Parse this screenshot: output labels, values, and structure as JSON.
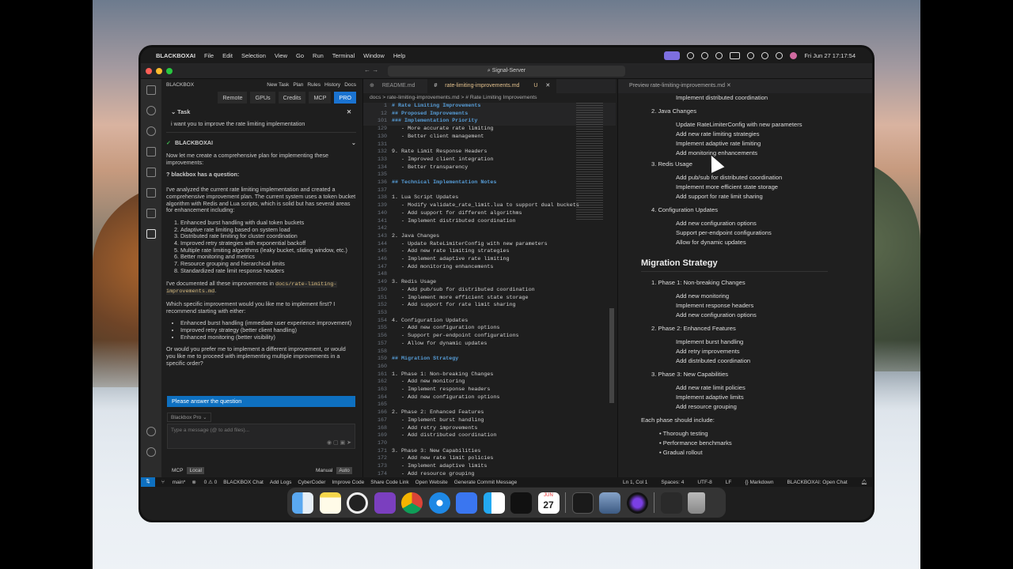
{
  "menubar": {
    "app": "BLACKBOXAI",
    "items": [
      "File",
      "Edit",
      "Selection",
      "View",
      "Go",
      "Run",
      "Terminal",
      "Window",
      "Help"
    ],
    "clock": "Fri Jun 27  17:17:54"
  },
  "titlebar": {
    "search": "Signal-Server"
  },
  "sidebar": {
    "title": "BLACKBOX",
    "links": [
      "New Task",
      "Plan",
      "Rules",
      "History",
      "Docs"
    ],
    "tabs": [
      "Remote",
      "GPUs",
      "Credits",
      "MCP",
      "PRO"
    ],
    "task_label": "Task",
    "task_text": "i want you to improve the rate limiting implementation",
    "agent_name": "BLACKBOXAI",
    "intro": "Now let me create a comprehensive plan for implementing these improvements:",
    "question_title": "blackbox has a question:",
    "analysis": "I've analyzed the current rate limiting implementation and created a comprehensive improvement plan. The current system uses a token bucket algorithm with Redis and Lua scripts, which is solid but has several areas for enhancement including:",
    "list": [
      "Enhanced burst handling with dual token buckets",
      "Adaptive rate limiting based on system load",
      "Distributed rate limiting for cluster coordination",
      "Improved retry strategies with exponential backoff",
      "Multiple rate limiting algorithms (leaky bucket, sliding window, etc.)",
      "Better monitoring and metrics",
      "Resource grouping and hierarchical limits",
      "Standardized rate limit response headers"
    ],
    "doc_prefix": "I've documented all these improvements in",
    "doc_path": "docs/rate-limiting-improvements.md",
    "which": "Which specific improvement would you like me to implement first? I recommend starting with either:",
    "recommend": [
      "Enhanced burst handling (immediate user experience improvement)",
      "Improved retry strategy (better client handling)",
      "Enhanced monitoring (better visibility)"
    ],
    "or_text": "Or would you prefer me to implement a different improvement, or would you like me to proceed with implementing multiple improvements in a specific order?",
    "answer_button": "Please answer the question",
    "model": "Blackbox Pro",
    "input_placeholder": "Type a message (@ to add files)...",
    "mcp": "MCP",
    "local": "Local",
    "manual": "Manual",
    "auto": "Auto"
  },
  "editor": {
    "tabs": [
      "README.md",
      "rate-limiting-improvements.md"
    ],
    "tab_badge": "U",
    "breadcrumb": "docs  >  rate-limiting-improvements.md  >  # Rate Limiting Improvements",
    "lines": [
      {
        "n": "1",
        "t": "# Rate Limiting Improvements",
        "h": true
      },
      {
        "n": "12",
        "t": "## Proposed Improvements",
        "h": true
      },
      {
        "n": "101",
        "t": "### Implementation Priority",
        "h": true
      },
      {
        "n": "129",
        "t": "   - More accurate rate limiting"
      },
      {
        "n": "130",
        "t": "   - Better client management"
      },
      {
        "n": "131",
        "t": ""
      },
      {
        "n": "132",
        "t": "9. Rate Limit Response Headers"
      },
      {
        "n": "133",
        "t": "   - Improved client integration"
      },
      {
        "n": "134",
        "t": "   - Better transparency"
      },
      {
        "n": "135",
        "t": ""
      },
      {
        "n": "136",
        "t": "## Technical Implementation Notes",
        "h": true
      },
      {
        "n": "137",
        "t": ""
      },
      {
        "n": "138",
        "t": "1. Lua Script Updates"
      },
      {
        "n": "139",
        "t": "   - Modify validate_rate_limit.lua to support dual buckets"
      },
      {
        "n": "140",
        "t": "   - Add support for different algorithms"
      },
      {
        "n": "141",
        "t": "   - Implement distributed coordination"
      },
      {
        "n": "142",
        "t": ""
      },
      {
        "n": "143",
        "t": "2. Java Changes"
      },
      {
        "n": "144",
        "t": "   - Update RateLimiterConfig with new parameters"
      },
      {
        "n": "145",
        "t": "   - Add new rate limiting strategies"
      },
      {
        "n": "146",
        "t": "   - Implement adaptive rate limiting"
      },
      {
        "n": "147",
        "t": "   - Add monitoring enhancements"
      },
      {
        "n": "148",
        "t": ""
      },
      {
        "n": "149",
        "t": "3. Redis Usage"
      },
      {
        "n": "150",
        "t": "   - Add pub/sub for distributed coordination"
      },
      {
        "n": "151",
        "t": "   - Implement more efficient state storage"
      },
      {
        "n": "152",
        "t": "   - Add support for rate limit sharing"
      },
      {
        "n": "153",
        "t": ""
      },
      {
        "n": "154",
        "t": "4. Configuration Updates"
      },
      {
        "n": "155",
        "t": "   - Add new configuration options"
      },
      {
        "n": "156",
        "t": "   - Support per-endpoint configurations"
      },
      {
        "n": "157",
        "t": "   - Allow for dynamic updates"
      },
      {
        "n": "158",
        "t": ""
      },
      {
        "n": "159",
        "t": "## Migration Strategy",
        "h": true
      },
      {
        "n": "160",
        "t": ""
      },
      {
        "n": "161",
        "t": "1. Phase 1: Non-breaking Changes"
      },
      {
        "n": "162",
        "t": "   - Add new monitoring"
      },
      {
        "n": "163",
        "t": "   - Implement response headers"
      },
      {
        "n": "164",
        "t": "   - Add new configuration options"
      },
      {
        "n": "165",
        "t": ""
      },
      {
        "n": "166",
        "t": "2. Phase 2: Enhanced Features"
      },
      {
        "n": "167",
        "t": "   - Implement burst handling"
      },
      {
        "n": "168",
        "t": "   - Add retry improvements"
      },
      {
        "n": "169",
        "t": "   - Add distributed coordination"
      },
      {
        "n": "170",
        "t": ""
      },
      {
        "n": "171",
        "t": "3. Phase 3: New Capabilities"
      },
      {
        "n": "172",
        "t": "   - Add new rate limit policies"
      },
      {
        "n": "173",
        "t": "   - Implement adaptive limits"
      },
      {
        "n": "174",
        "t": "   - Add resource grouping"
      }
    ]
  },
  "preview": {
    "tab": "Preview rate-limiting-improvements.md",
    "top_item": "Implement distributed coordination",
    "java": "2. Java Changes",
    "java_items": [
      "Update RateLimiterConfig with new parameters",
      "Add new rate limiting strategies",
      "Implement adaptive rate limiting",
      "Add monitoring enhancements"
    ],
    "redis": "3. Redis Usage",
    "redis_items": [
      "Add pub/sub for distributed coordination",
      "Implement more efficient state storage",
      "Add support for rate limit sharing"
    ],
    "config": "4. Configuration Updates",
    "config_items": [
      "Add new configuration options",
      "Support per-endpoint configurations",
      "Allow for dynamic updates"
    ],
    "migration": "Migration Strategy",
    "p1": "1. Phase 1: Non-breaking Changes",
    "p1_items": [
      "Add new monitoring",
      "Implement response headers",
      "Add new configuration options"
    ],
    "p2": "2. Phase 2: Enhanced Features",
    "p2_items": [
      "Implement burst handling",
      "Add retry improvements",
      "Add distributed coordination"
    ],
    "p3": "3. Phase 3: New Capabilities",
    "p3_items": [
      "Add new rate limit policies",
      "Implement adaptive limits",
      "Add resource grouping"
    ],
    "each": "Each phase should include:",
    "each_items": [
      "Thorough testing",
      "Performance benchmarks",
      "Gradual rollout"
    ]
  },
  "statusbar": {
    "branch": "main*",
    "errors": "0 ⚠ 0",
    "items": [
      "BLACKBOX Chat",
      "Add Logs",
      "CyberCoder",
      "Improve Code",
      "Share Code Link",
      "Open Website",
      "Generate Commit Message"
    ],
    "right": [
      "Ln 1, Col 1",
      "Spaces: 4",
      "UTF-8",
      "LF",
      "{} Markdown",
      "BLACKBOXAI: Open Chat"
    ]
  },
  "dock": {
    "calendar_month": "JUN",
    "calendar_day": "27"
  },
  "colors": {
    "accent": "#0e70c0",
    "pro": "#1a73d1",
    "heading": "#569cd6"
  }
}
